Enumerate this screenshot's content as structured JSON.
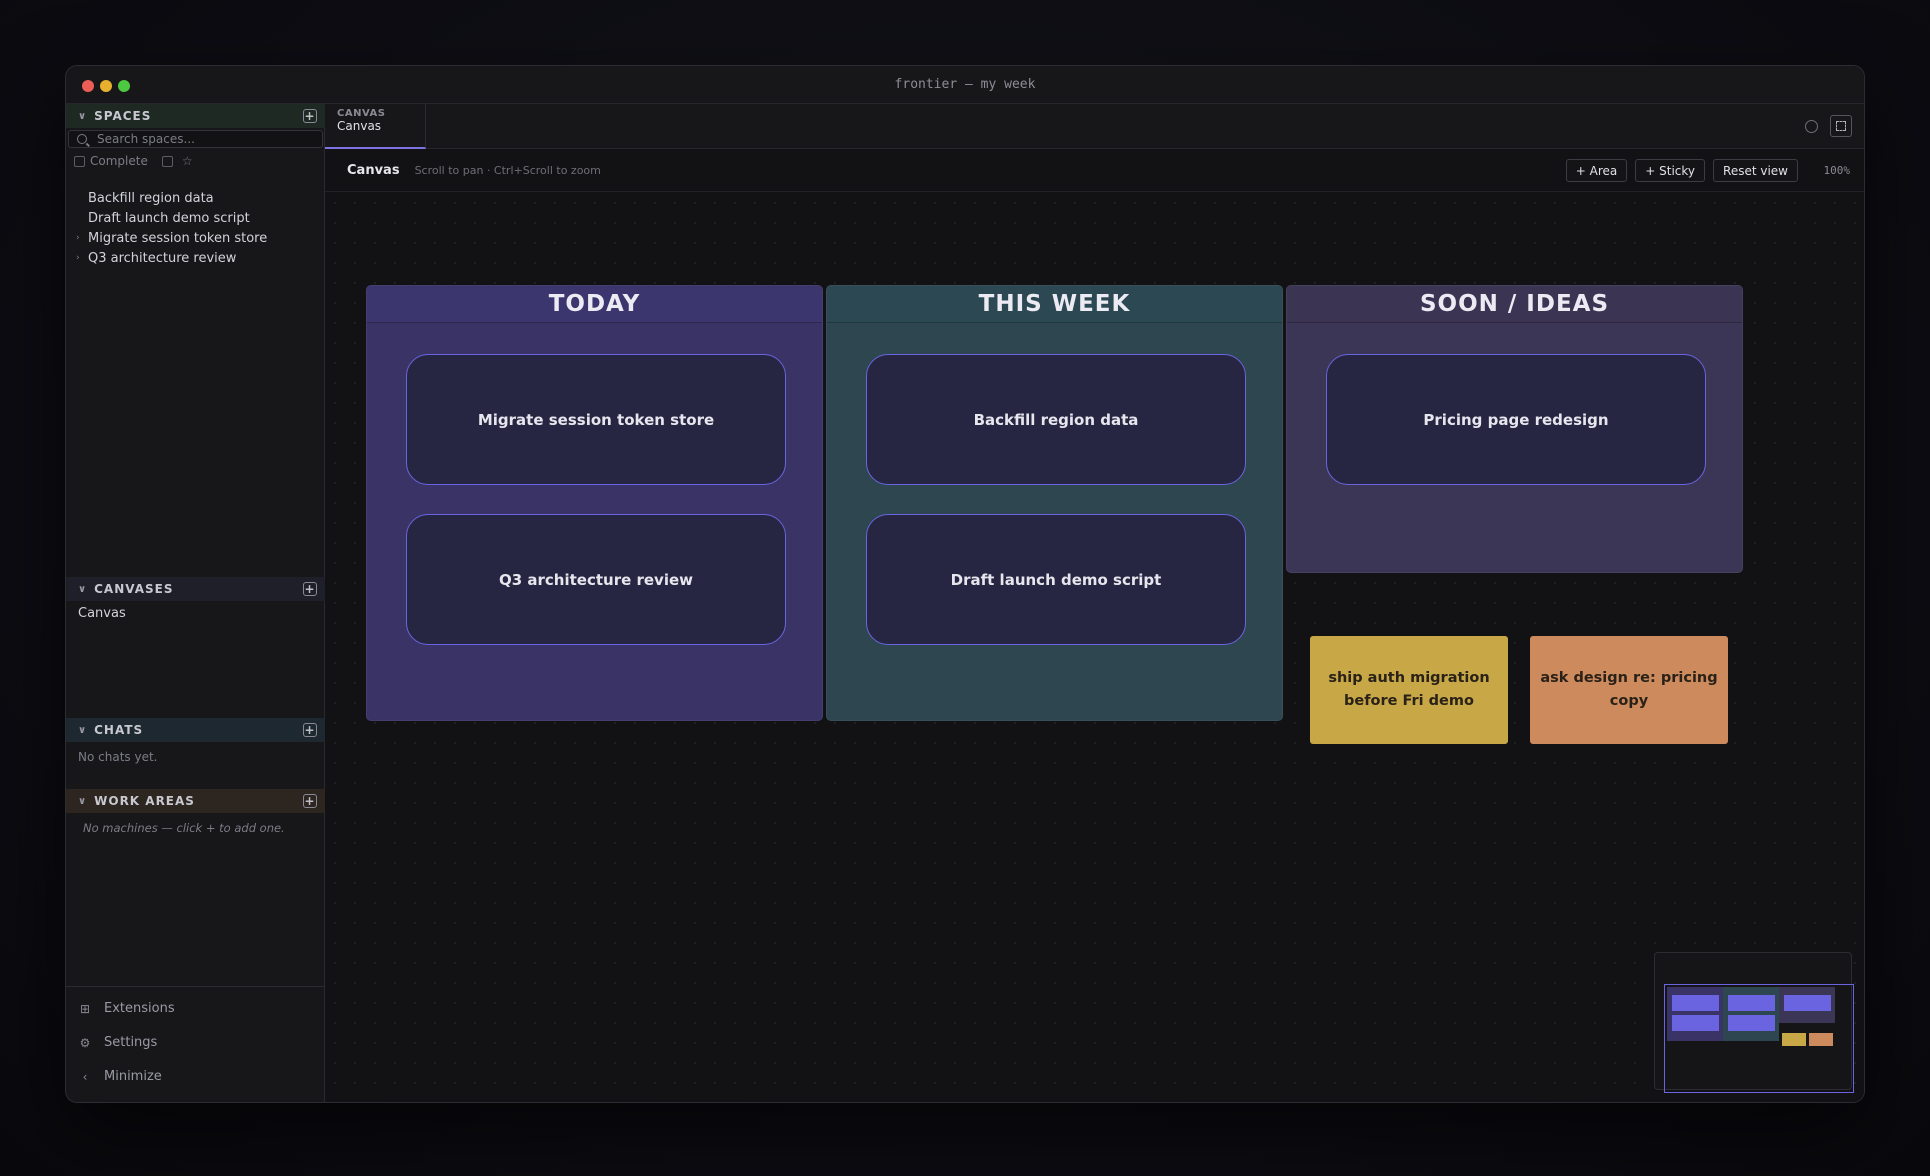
{
  "window": {
    "title": "frontier — my week"
  },
  "sidebar": {
    "spaces": {
      "header": "SPACES",
      "search_placeholder": "Search spaces...",
      "filter_complete": "Complete",
      "items": [
        {
          "label": "Backfill region data",
          "expandable": false
        },
        {
          "label": "Draft launch demo script",
          "expandable": false
        },
        {
          "label": "Migrate session token store",
          "expandable": true
        },
        {
          "label": "Q3 architecture review",
          "expandable": true
        }
      ]
    },
    "canvases": {
      "header": "CANVASES",
      "items": [
        "Canvas"
      ]
    },
    "chats": {
      "header": "CHATS",
      "empty": "No chats yet."
    },
    "work_areas": {
      "header": "WORK AREAS",
      "empty": "No machines — click + to add one."
    },
    "bottom": {
      "extensions": "Extensions",
      "settings": "Settings",
      "minimize": "Minimize"
    }
  },
  "tab": {
    "kind": "CANVAS",
    "name": "Canvas"
  },
  "toolbar": {
    "title": "Canvas",
    "hint": "Scroll to pan · Ctrl+Scroll to zoom",
    "add_area": "+ Area",
    "add_sticky": "+ Sticky",
    "reset_view": "Reset view",
    "zoom": "100%"
  },
  "canvas": {
    "areas": [
      {
        "title": "TODAY",
        "color": "#3a3366",
        "cards": [
          "Migrate session token store",
          "Q3 architecture review"
        ]
      },
      {
        "title": "THIS WEEK",
        "color": "#2d4650",
        "cards": [
          "Backfill region data",
          "Draft launch demo script"
        ]
      },
      {
        "title": "SOON / IDEAS",
        "color": "#3b3556",
        "cards": [
          "Pricing page redesign"
        ]
      }
    ],
    "stickies": [
      {
        "text": "ship auth migration before Fri demo",
        "color": "#c8a846"
      },
      {
        "text": "ask design re: pricing copy",
        "color": "#cd8a5c"
      }
    ]
  },
  "colors": {
    "accent": "#6b64e0"
  }
}
